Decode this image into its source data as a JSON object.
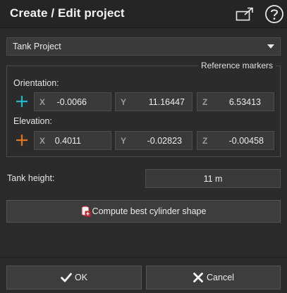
{
  "dialog": {
    "title": "Create / Edit project",
    "icons": {
      "external": "external-window-icon",
      "help": "help-icon"
    }
  },
  "project_select": {
    "value": "Tank Project"
  },
  "reference_markers": {
    "title": "Reference markers",
    "orientation": {
      "label": "Orientation:",
      "marker_color": "#20b8c8",
      "x_label": "X",
      "x_value": "-0.0066",
      "y_label": "Y",
      "y_value": "11.16447",
      "z_label": "Z",
      "z_value": "6.53413"
    },
    "elevation": {
      "label": "Elevation:",
      "marker_color": "#e0741f",
      "x_label": "X",
      "x_value": "0.4011",
      "y_label": "Y",
      "y_value": "-0.02823",
      "z_label": "Z",
      "z_value": "-0.00458"
    }
  },
  "tank_height": {
    "label": "Tank height:",
    "value": "11 m"
  },
  "compute_button": {
    "label": "Compute best cylinder shape",
    "icon": "cylinder-icon"
  },
  "footer": {
    "ok_label": "OK",
    "cancel_label": "Cancel",
    "ok_icon": "checkmark-icon",
    "cancel_icon": "cross-icon"
  }
}
